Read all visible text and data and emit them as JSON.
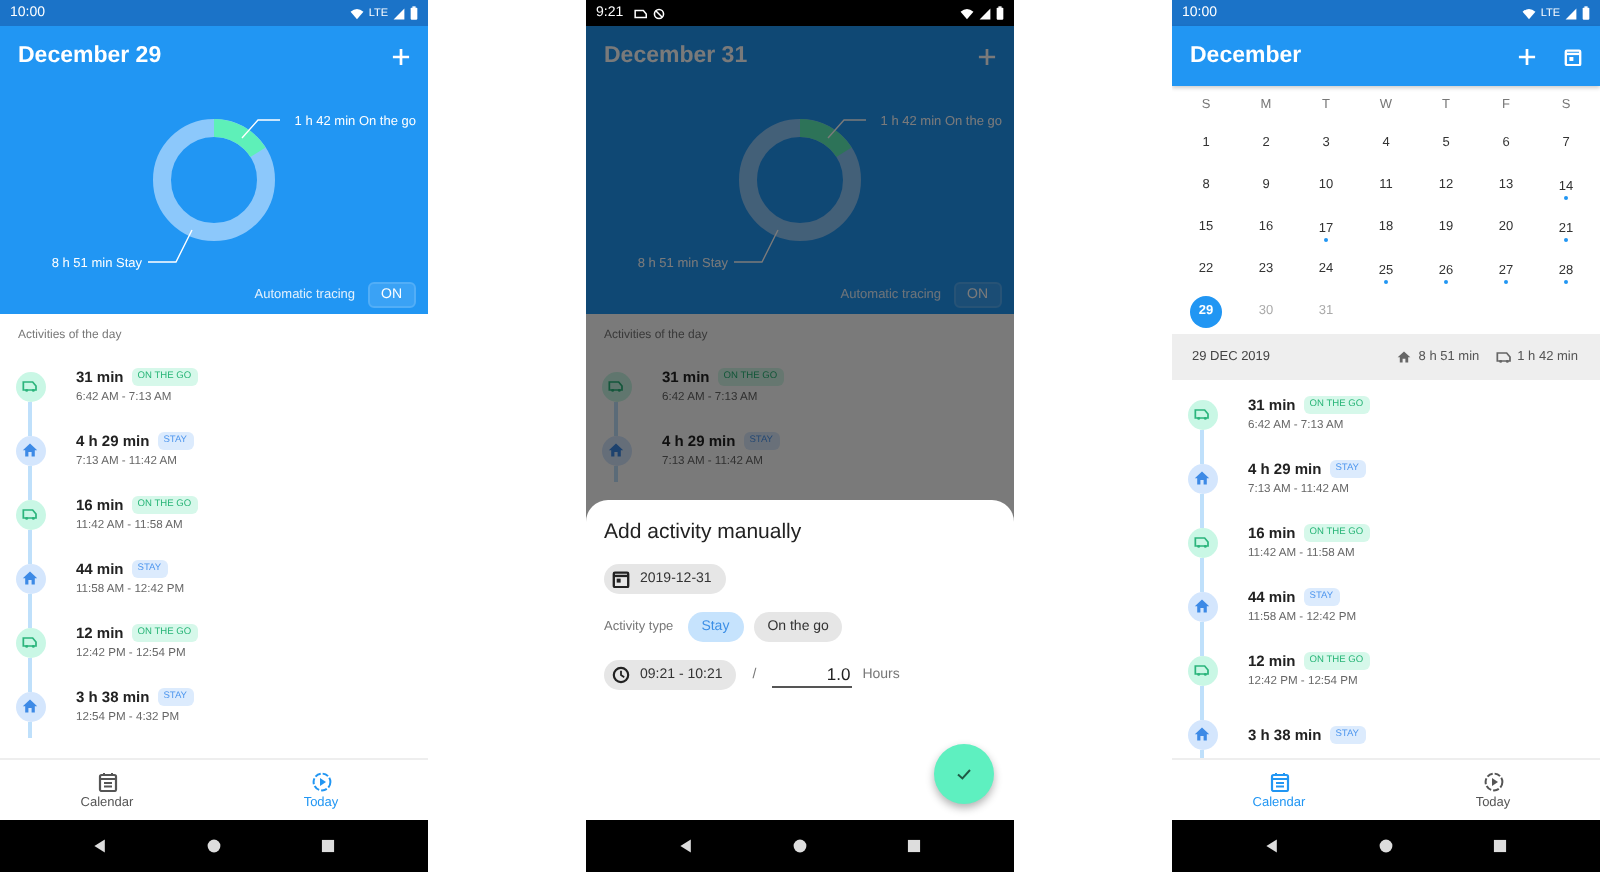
{
  "screens": [
    {
      "kind": "today",
      "status_bar": {
        "time": "10:00",
        "network": "LTE"
      },
      "app_bar": {
        "title": "December 29"
      },
      "summary": {
        "donut": {
          "level": 0.161,
          "labels": [
            "1 h 42 min On the go",
            "8 h 51 min Stay"
          ]
        },
        "tracing_label": "Automatic tracing",
        "tracing_button": "ON"
      },
      "list_title": "Activities of the day",
      "activities": [
        {
          "kind": "on_the_go",
          "duration": "31 min",
          "tag": "ON THE GO",
          "time": "6:42 AM - 7:13 AM"
        },
        {
          "kind": "stay",
          "duration": "4 h 29 min",
          "tag": "STAY",
          "time": "7:13 AM - 11:42 AM"
        },
        {
          "kind": "on_the_go",
          "duration": "16 min",
          "tag": "ON THE GO",
          "time": "11:42 AM - 11:58 AM"
        },
        {
          "kind": "stay",
          "duration": "44 min",
          "tag": "STAY",
          "time": "11:58 AM - 12:42 PM"
        },
        {
          "kind": "on_the_go",
          "duration": "12 min",
          "tag": "ON THE GO",
          "time": "12:42 PM - 12:54 PM"
        },
        {
          "kind": "stay",
          "duration": "3 h 38 min",
          "tag": "STAY",
          "time": "12:54 PM - 4:32 PM"
        }
      ],
      "bottom_nav": [
        {
          "kind": "calendar",
          "label": "Calendar",
          "selected": false
        },
        {
          "kind": "today",
          "label": "Today",
          "selected": true
        }
      ]
    },
    {
      "kind": "add_activity",
      "status_bar": {
        "time": "9:21"
      },
      "app_bar": {
        "title": "December 31"
      },
      "summary": {
        "donut": {
          "level": 0.161,
          "labels": [
            "1 h 42 min On the go",
            "8 h 51 min Stay"
          ]
        },
        "tracing_label": "Automatic tracing",
        "tracing_button": "ON"
      },
      "list_title": "Activities of the day",
      "activities": [
        {
          "kind": "on_the_go",
          "duration": "31 min",
          "tag": "ON THE GO",
          "time": "6:42 AM - 7:13 AM"
        },
        {
          "kind": "stay",
          "duration": "4 h 29 min",
          "tag": "STAY",
          "time": "7:13 AM - 11:42 AM"
        }
      ],
      "sheet": {
        "title": "Add activity manually",
        "date": "2019-12-31",
        "type_label": "Activity type",
        "type_options": [
          {
            "label": "Stay",
            "selected": true
          },
          {
            "label": "On the go",
            "selected": false
          }
        ],
        "time_range": "09:21 - 10:21",
        "separator": "/",
        "duration": "1.0",
        "unit": "Hours"
      }
    },
    {
      "kind": "calendar",
      "status_bar": {
        "time": "10:00",
        "network": "LTE"
      },
      "app_bar": {
        "title": "December"
      },
      "calendar": {
        "weekdays": [
          "S",
          "M",
          "T",
          "W",
          "T",
          "F",
          "S"
        ],
        "days": [
          {
            "label": "1",
            "has_entry": false,
            "selected": false,
            "disabled": false
          },
          {
            "label": "2",
            "has_entry": false,
            "selected": false,
            "disabled": false
          },
          {
            "label": "3",
            "has_entry": false,
            "selected": false,
            "disabled": false
          },
          {
            "label": "4",
            "has_entry": false,
            "selected": false,
            "disabled": false
          },
          {
            "label": "5",
            "has_entry": false,
            "selected": false,
            "disabled": false
          },
          {
            "label": "6",
            "has_entry": false,
            "selected": false,
            "disabled": false
          },
          {
            "label": "7",
            "has_entry": false,
            "selected": false,
            "disabled": false
          },
          {
            "label": "8",
            "has_entry": false,
            "selected": false,
            "disabled": false
          },
          {
            "label": "9",
            "has_entry": false,
            "selected": false,
            "disabled": false
          },
          {
            "label": "10",
            "has_entry": false,
            "selected": false,
            "disabled": false
          },
          {
            "label": "11",
            "has_entry": false,
            "selected": false,
            "disabled": false
          },
          {
            "label": "12",
            "has_entry": false,
            "selected": false,
            "disabled": false
          },
          {
            "label": "13",
            "has_entry": false,
            "selected": false,
            "disabled": false
          },
          {
            "label": "14",
            "has_entry": true,
            "selected": false,
            "disabled": false
          },
          {
            "label": "15",
            "has_entry": false,
            "selected": false,
            "disabled": false
          },
          {
            "label": "16",
            "has_entry": false,
            "selected": false,
            "disabled": false
          },
          {
            "label": "17",
            "has_entry": true,
            "selected": false,
            "disabled": false
          },
          {
            "label": "18",
            "has_entry": false,
            "selected": false,
            "disabled": false
          },
          {
            "label": "19",
            "has_entry": false,
            "selected": false,
            "disabled": false
          },
          {
            "label": "20",
            "has_entry": false,
            "selected": false,
            "disabled": false
          },
          {
            "label": "21",
            "has_entry": true,
            "selected": false,
            "disabled": false
          },
          {
            "label": "22",
            "has_entry": false,
            "selected": false,
            "disabled": false
          },
          {
            "label": "23",
            "has_entry": false,
            "selected": false,
            "disabled": false
          },
          {
            "label": "24",
            "has_entry": false,
            "selected": false,
            "disabled": false
          },
          {
            "label": "25",
            "has_entry": true,
            "selected": false,
            "disabled": false
          },
          {
            "label": "26",
            "has_entry": true,
            "selected": false,
            "disabled": false
          },
          {
            "label": "27",
            "has_entry": true,
            "selected": false,
            "disabled": false
          },
          {
            "label": "28",
            "has_entry": true,
            "selected": false,
            "disabled": false
          },
          {
            "label": "29",
            "has_entry": false,
            "selected": true,
            "disabled": false
          },
          {
            "label": "30",
            "has_entry": false,
            "selected": false,
            "disabled": true
          },
          {
            "label": "31",
            "has_entry": false,
            "selected": false,
            "disabled": true
          }
        ]
      },
      "day_summary": {
        "date": "29 DEC 2019",
        "stay": "8 h 51 min",
        "on_the_go": "1 h 42 min"
      },
      "activities": [
        {
          "kind": "on_the_go",
          "duration": "31 min",
          "tag": "ON THE GO",
          "time": "6:42 AM - 7:13 AM"
        },
        {
          "kind": "stay",
          "duration": "4 h 29 min",
          "tag": "STAY",
          "time": "7:13 AM - 11:42 AM"
        },
        {
          "kind": "on_the_go",
          "duration": "16 min",
          "tag": "ON THE GO",
          "time": "11:42 AM - 11:58 AM"
        },
        {
          "kind": "stay",
          "duration": "44 min",
          "tag": "STAY",
          "time": "11:58 AM - 12:42 PM"
        },
        {
          "kind": "on_the_go",
          "duration": "12 min",
          "tag": "ON THE GO",
          "time": "12:42 PM - 12:54 PM"
        },
        {
          "kind": "stay",
          "duration": "3 h 38 min",
          "tag": "STAY"
        }
      ],
      "bottom_nav": [
        {
          "kind": "calendar",
          "label": "Calendar",
          "selected": true
        },
        {
          "kind": "today",
          "label": "Today",
          "selected": false
        }
      ]
    }
  ]
}
